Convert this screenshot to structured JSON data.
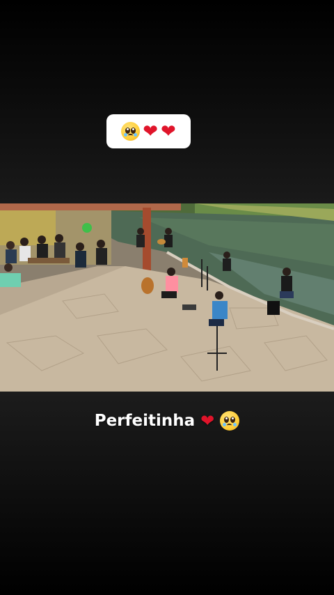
{
  "sticker": {
    "emojis": [
      "pleading-face",
      "red-heart",
      "red-heart"
    ]
  },
  "video": {
    "scene": "live acoustic music session by a lake",
    "description_hidden": true
  },
  "caption": {
    "text": "Perfeitinha",
    "emojis": [
      "red-heart",
      "pleading-face"
    ]
  },
  "colors": {
    "heart": "#e0142a",
    "sticker_bg": "#ffffff",
    "caption_text": "#ffffff"
  }
}
